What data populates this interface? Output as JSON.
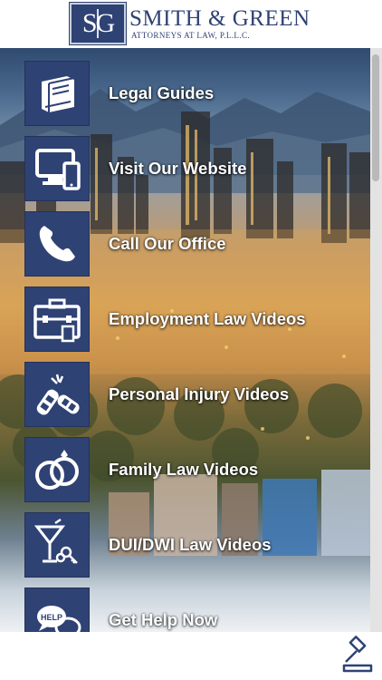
{
  "header": {
    "logo_mark": "SG",
    "firm_name": "SMITH & GREEN",
    "firm_subtitle": "ATTORNEYS AT LAW, P.L.L.C."
  },
  "colors": {
    "tile": "#2f4274",
    "label": "#ffffff"
  },
  "menu": {
    "items": [
      {
        "label": "Legal Guides",
        "icon": "book-icon"
      },
      {
        "label": "Visit Our Website",
        "icon": "devices-icon"
      },
      {
        "label": "Call Our Office",
        "icon": "phone-icon"
      },
      {
        "label": "Employment Law Videos",
        "icon": "briefcase-icon"
      },
      {
        "label": "Personal Injury Videos",
        "icon": "car-crash-icon"
      },
      {
        "label": "Family Law Videos",
        "icon": "rings-icon"
      },
      {
        "label": "DUI/DWI Law Videos",
        "icon": "cocktail-keys-icon"
      },
      {
        "label": "Get Help Now",
        "icon": "help-bubble-icon"
      }
    ]
  },
  "footer": {
    "icon": "gavel-icon"
  }
}
